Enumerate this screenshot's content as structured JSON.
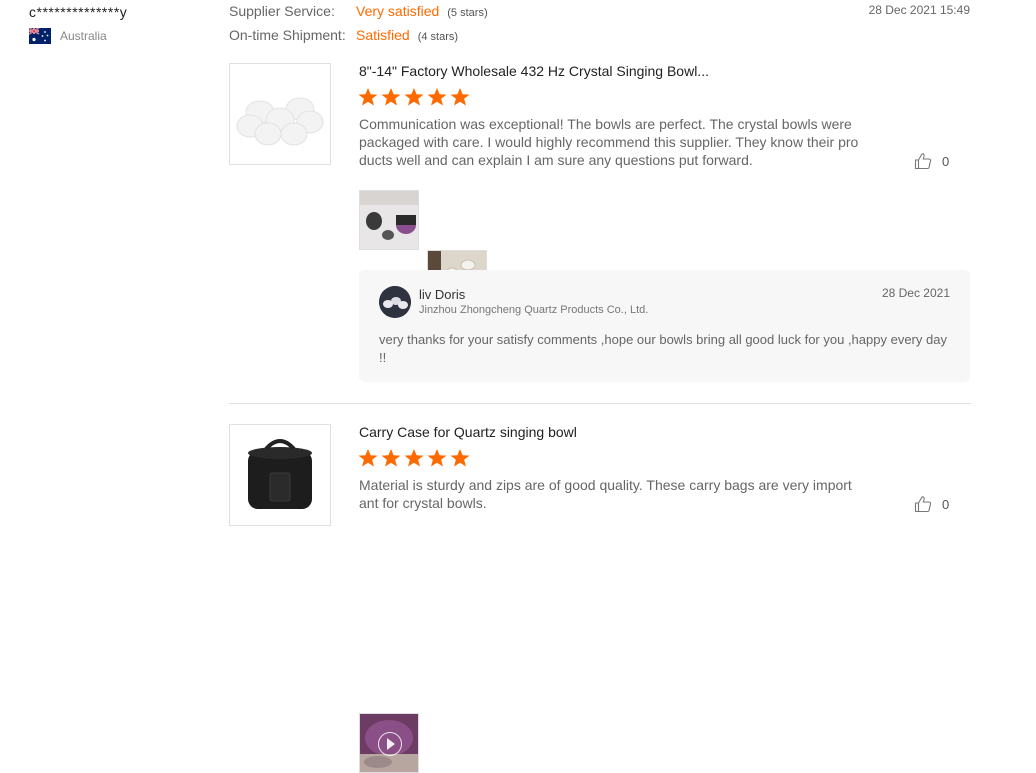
{
  "reviewer": {
    "name": "c**************y",
    "country": "Australia"
  },
  "ratings": [
    {
      "label": "Supplier Service:",
      "value": "Very satisfied",
      "stars": "(5 stars)"
    },
    {
      "label": "On-time Shipment:",
      "value": "Satisfied",
      "stars": "(4 stars)"
    }
  ],
  "review_date": "28 Dec 2021 15:49",
  "products": [
    {
      "title": "8\"-14\" Factory Wholesale 432 Hz Crystal Singing Bowl...",
      "rating": 5,
      "text": "Communication was exceptional! The bowls are perfect. The crystal bowls were packaged with care. I would highly recommend this supplier. They know their products well and can explain I am sure any questions put forward.",
      "likes": "0",
      "media": [
        "photo",
        "photo",
        "video"
      ]
    },
    {
      "title": "Carry Case for Quartz singing bowl",
      "rating": 5,
      "text": "Material is sturdy and zips are of good quality. These carry bags are very important for crystal bowls.",
      "likes": "0",
      "media": [
        "video"
      ]
    }
  ],
  "reply": {
    "name": "liv Doris",
    "company": "Jinzhou Zhongcheng Quartz Products Co., Ltd.",
    "date": "28 Dec 2021",
    "text": "very thanks for your satisfy comments ,hope our bowls bring all good luck for you ,happy every day !!"
  },
  "colors": {
    "accent": "#ff6a00",
    "star": "#ff6a00",
    "reply_bg": "#f7f7f7"
  },
  "icons": {
    "like": "thumbs-up-icon",
    "play": "play-icon",
    "flag": "australia-flag-icon"
  }
}
